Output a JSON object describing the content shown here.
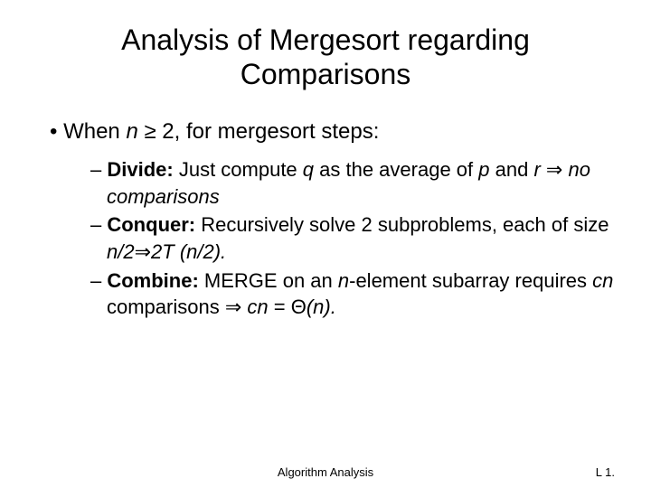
{
  "title_line1": "Analysis of Mergesort regarding",
  "title_line2": "Comparisons",
  "main": {
    "prefix": "• When ",
    "var_n": "n",
    "mid": " ≥ 2, for mergesort steps:"
  },
  "items": [
    {
      "dash": "– ",
      "label": "Divide: ",
      "text1": "Just compute ",
      "var1": "q",
      "text2": " as the average of ",
      "var2": "p",
      "text3": " and ",
      "var3": "r",
      "arrow": " ⇒ ",
      "emph": "no comparisons"
    },
    {
      "dash": "– ",
      "label": "Conquer: ",
      "text1": "Recursively solve 2 subproblems, each of size ",
      "var1": "n/2",
      "arrow": "⇒",
      "var2": "2T (n/2)."
    },
    {
      "dash": "– ",
      "label": "Combine: ",
      "text1": "MERGE on an ",
      "var1": "n",
      "text2": "-element subarray requires ",
      "var2": "cn",
      "text3": " comparisons ⇒ ",
      "var3": "cn",
      "text4": " = Θ",
      "var4": "(n)."
    }
  ],
  "footer_center": "Algorithm Analysis",
  "footer_right": "L 1."
}
